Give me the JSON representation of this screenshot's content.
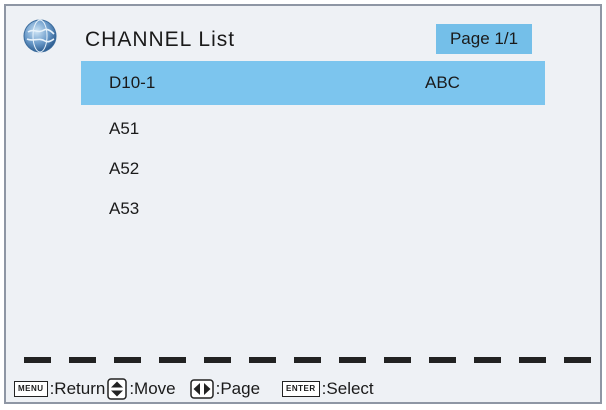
{
  "header": {
    "title": "CHANNEL  List",
    "page_indicator": "Page 1/1"
  },
  "channels": [
    {
      "name": "D10-1",
      "service": "ABC",
      "selected": true
    },
    {
      "name": "A51",
      "service": ""
    },
    {
      "name": "A52",
      "service": ""
    },
    {
      "name": "A53",
      "service": ""
    }
  ],
  "footer": {
    "menu_key": "MENU",
    "menu_label": ":Return",
    "move_label": ":Move",
    "page_label": ":Page",
    "enter_key": "ENTER",
    "enter_label": ":Select"
  },
  "colors": {
    "highlight": "#7cc5ee",
    "badge": "#74bfe9",
    "panel_bg": "#eef1f5"
  },
  "icons": [
    "globe-icon",
    "menu-key-icon",
    "up-down-arrows-icon",
    "left-right-arrows-icon",
    "enter-key-icon"
  ]
}
